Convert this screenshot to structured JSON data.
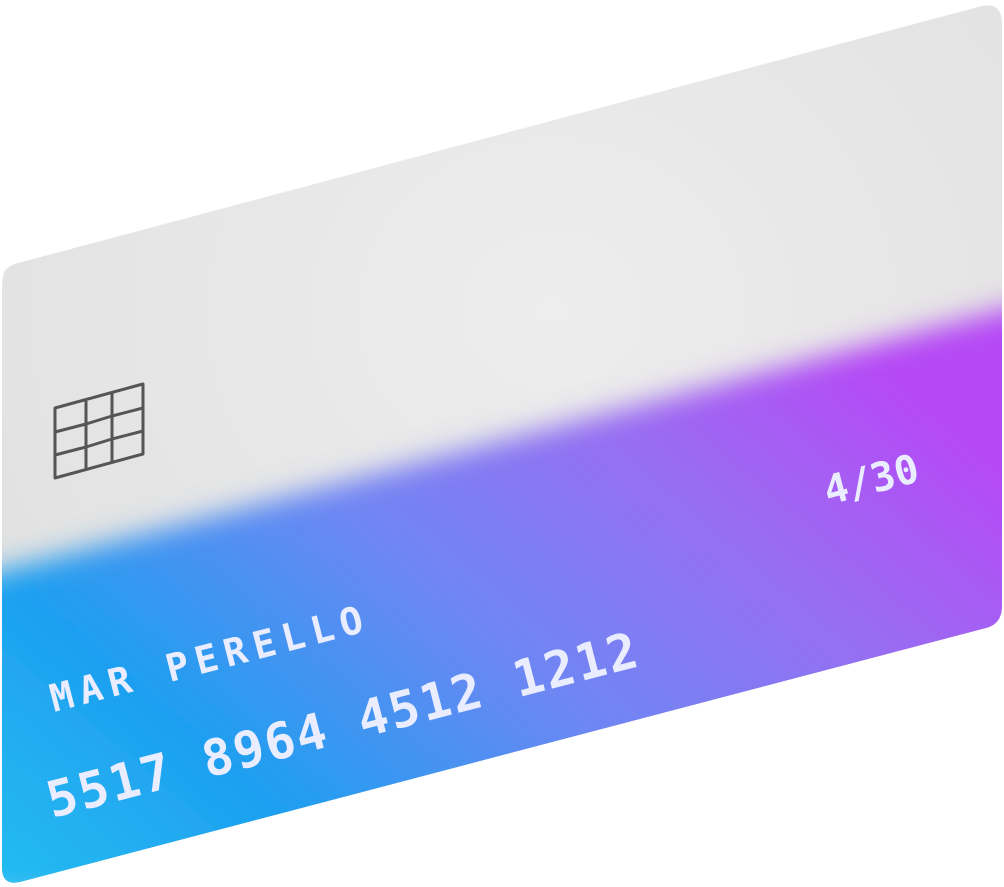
{
  "card": {
    "holder_name": "MAR PERELLO",
    "number": "5517 8964 4512 1212",
    "expiry": "4/30",
    "chip_icon": "chip-icon",
    "colors": {
      "top_silver": "#e6e6e6",
      "gradient_start": "#22b9f0",
      "gradient_mid": "#1f9df0",
      "gradient_purple": "#8b7bf2",
      "gradient_end": "#b246f5",
      "text": "#e9edff",
      "chip_stroke": "#555555"
    }
  }
}
